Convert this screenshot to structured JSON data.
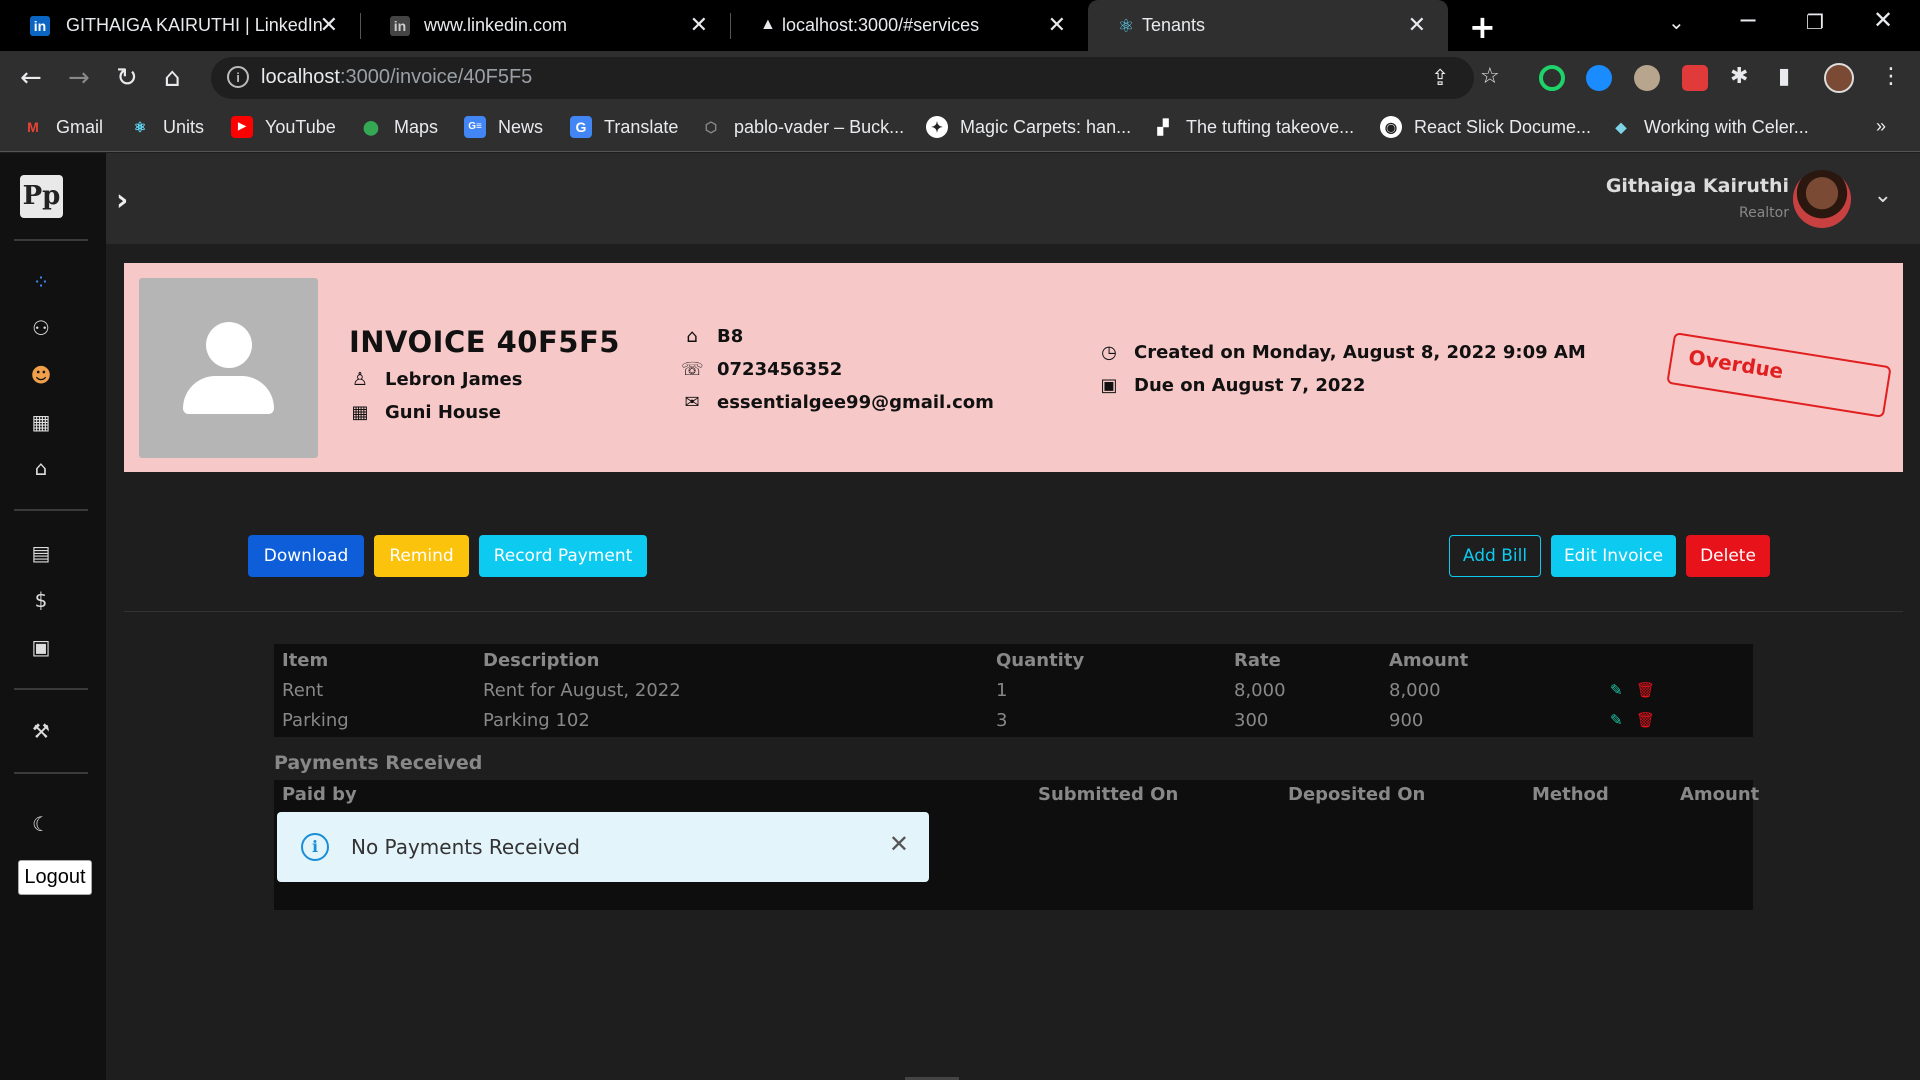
{
  "browser": {
    "tabs": [
      {
        "title": "GITHAIGA KAIRUTHI | LinkedIn",
        "favicon": "linkedin-icon"
      },
      {
        "title": "www.linkedin.com",
        "favicon": "linkedin-icon"
      },
      {
        "title": "localhost:3000/#services",
        "favicon": "triangle-icon"
      },
      {
        "title": "Tenants",
        "favicon": "react-icon",
        "active": true
      }
    ],
    "url_host": "localhost",
    "url_path": ":3000/invoice/40F5F5",
    "bookmarks": [
      {
        "label": "Gmail",
        "icon": "gmail-icon"
      },
      {
        "label": "Units",
        "icon": "react-icon"
      },
      {
        "label": "YouTube",
        "icon": "youtube-icon"
      },
      {
        "label": "Maps",
        "icon": "maps-icon"
      },
      {
        "label": "News",
        "icon": "news-icon"
      },
      {
        "label": "Translate",
        "icon": "translate-icon"
      },
      {
        "label": "pablo-vader – Buck...",
        "icon": "github-icon"
      },
      {
        "label": "Magic Carpets: han...",
        "icon": "site-icon"
      },
      {
        "label": "The tufting takeove...",
        "icon": "site-icon"
      },
      {
        "label": "React Slick Docume...",
        "icon": "globe-icon"
      },
      {
        "label": "Working with Celer...",
        "icon": "cube-icon"
      }
    ],
    "more_bookmarks": "»"
  },
  "sidebar": {
    "logo": "Pp",
    "logout_label": "Logout"
  },
  "topbar": {
    "user_name": "Githaiga Kairuthi",
    "user_role": "Realtor"
  },
  "invoice": {
    "title": "INVOICE 40F5F5",
    "tenant_name": "Lebron James",
    "property": "Guni House",
    "unit": "B8",
    "phone": "0723456352",
    "email": "essentialgee99@gmail.com",
    "created": "Created on Monday, August 8, 2022 9:09 AM",
    "due": "Due on August 7, 2022",
    "status": "Overdue",
    "status_color": "#e02020"
  },
  "actions": {
    "download": "Download",
    "remind": "Remind",
    "record_payment": "Record Payment",
    "add_bill": "Add Bill",
    "edit_invoice": "Edit Invoice",
    "delete": "Delete"
  },
  "bills": {
    "headers": [
      "Item",
      "Description",
      "Quantity",
      "Rate",
      "Amount"
    ],
    "rows": [
      {
        "item": "Rent",
        "description": "Rent for August, 2022",
        "quantity": "1",
        "rate": "8,000",
        "amount": "8,000"
      },
      {
        "item": "Parking",
        "description": "Parking 102",
        "quantity": "3",
        "rate": "300",
        "amount": "900"
      }
    ]
  },
  "payments": {
    "title": "Payments Received",
    "headers": [
      "Paid by",
      "Submitted On",
      "Deposited On",
      "Method",
      "Amount"
    ],
    "empty_message": "No Payments Received"
  }
}
